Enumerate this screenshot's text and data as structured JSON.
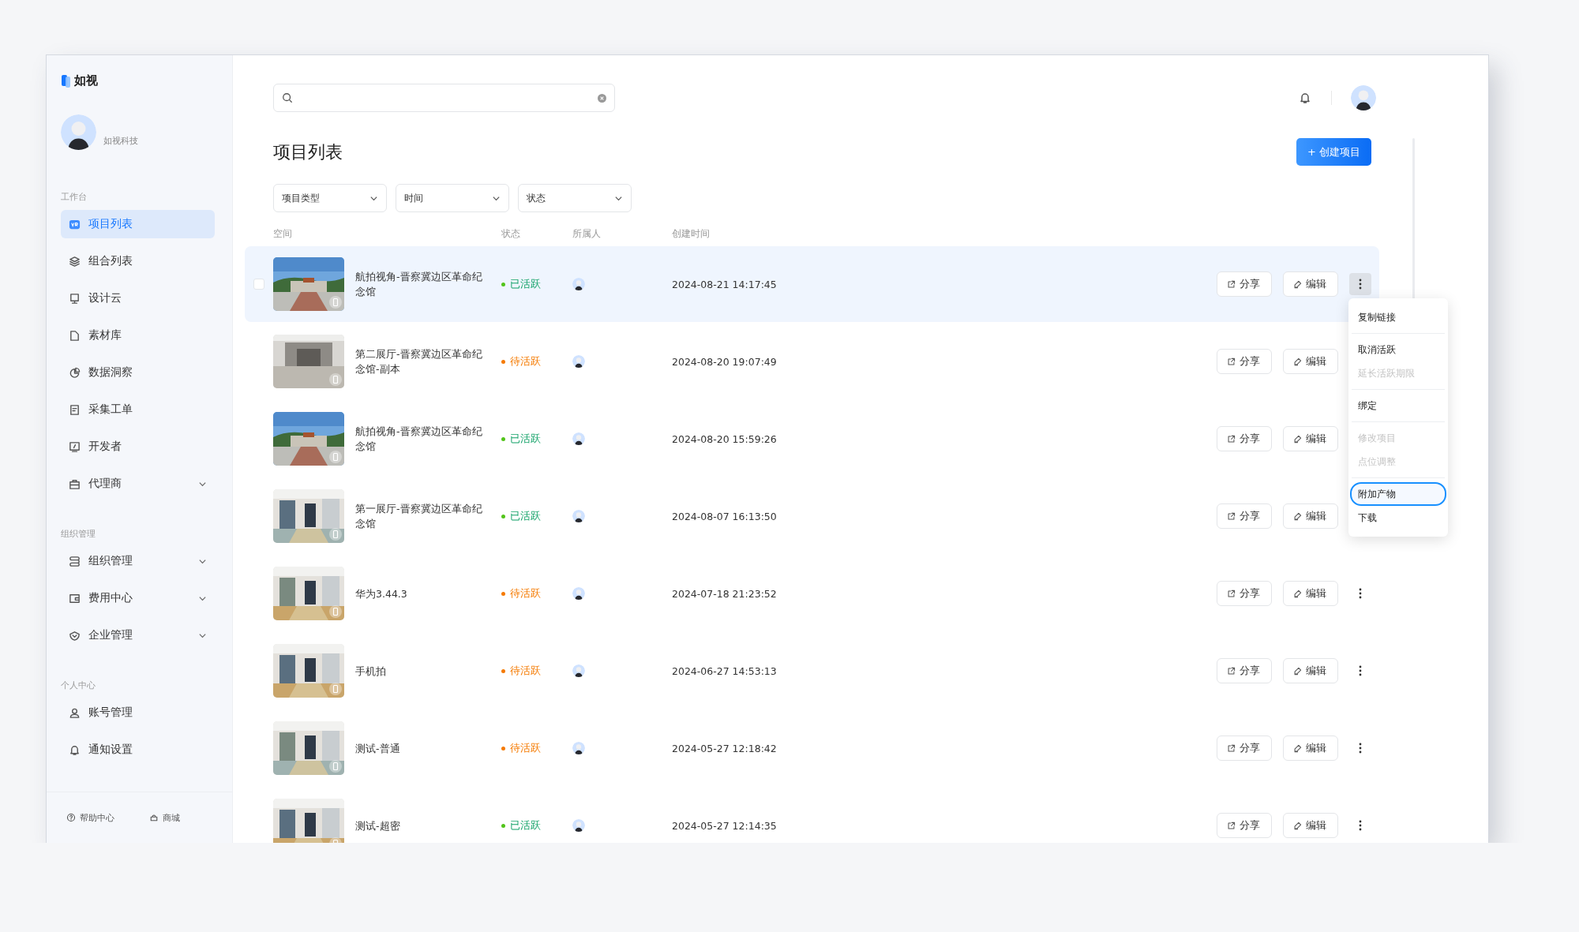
{
  "sidebar": {
    "logo_text": "如视",
    "user_name": "如视科技",
    "sections": [
      {
        "label": "工作台",
        "items": [
          {
            "label": "项目列表",
            "selected": true,
            "has_submenu": false
          },
          {
            "label": "组合列表",
            "selected": false,
            "has_submenu": false
          },
          {
            "label": "设计云",
            "selected": false,
            "has_submenu": false
          },
          {
            "label": "素材库",
            "selected": false,
            "has_submenu": false
          },
          {
            "label": "数据洞察",
            "selected": false,
            "has_submenu": false
          },
          {
            "label": "采集工单",
            "selected": false,
            "has_submenu": false
          },
          {
            "label": "开发者",
            "selected": false,
            "has_submenu": false
          },
          {
            "label": "代理商",
            "selected": false,
            "has_submenu": true
          }
        ]
      },
      {
        "label": "组织管理",
        "items": [
          {
            "label": "组织管理",
            "selected": false,
            "has_submenu": true
          },
          {
            "label": "费用中心",
            "selected": false,
            "has_submenu": true
          },
          {
            "label": "企业管理",
            "selected": false,
            "has_submenu": true
          }
        ]
      },
      {
        "label": "个人中心",
        "items": [
          {
            "label": "账号管理",
            "selected": false,
            "has_submenu": false
          },
          {
            "label": "通知设置",
            "selected": false,
            "has_submenu": false
          }
        ]
      }
    ],
    "footer_links": [
      "帮助中心",
      "商城"
    ]
  },
  "title": "项目列表",
  "create_button": "+ 创建项目",
  "filters": [
    "项目类型",
    "时间",
    "状态"
  ],
  "columns": [
    "空间",
    "状态",
    "所属人",
    "创建时间"
  ],
  "rows": [
    {
      "name": "航拍视角-晋察冀边区革命纪念馆",
      "status": "已活跃",
      "color": "#52c41a",
      "date": "2024-08-21 14:17:45",
      "selected": true,
      "share": "分享",
      "edit": "编辑"
    },
    {
      "name": "第二展厅-晋察冀边区革命纪念馆-副本",
      "status": "待活跃",
      "color": "#f57a00",
      "date": "2024-08-20 19:07:49",
      "selected": false,
      "share": "分享",
      "edit": "编辑"
    },
    {
      "name": "航拍视角-晋察冀边区革命纪念馆",
      "status": "已活跃",
      "color": "#52c41a",
      "date": "2024-08-20 15:59:26",
      "selected": false,
      "share": "分享",
      "edit": "编辑"
    },
    {
      "name": "第一展厅-晋察冀边区革命纪念馆",
      "status": "已活跃",
      "color": "#52c41a",
      "date": "2024-08-07 16:13:50",
      "selected": false,
      "share": "分享",
      "edit": "编辑"
    },
    {
      "name": "华为3.44.3",
      "status": "待活跃",
      "color": "#f57a00",
      "date": "2024-07-18 21:23:52",
      "selected": false,
      "share": "分享",
      "edit": "编辑"
    },
    {
      "name": "手机拍",
      "status": "待活跃",
      "color": "#f57a00",
      "date": "2024-06-27 14:53:13",
      "selected": false,
      "share": "分享",
      "edit": "编辑"
    },
    {
      "name": "测试-普通",
      "status": "待活跃",
      "color": "#f57a00",
      "date": "2024-05-27 12:18:42",
      "selected": false,
      "share": "分享",
      "edit": "编辑"
    },
    {
      "name": "测试-超密",
      "status": "已活跃",
      "color": "#52c41a",
      "date": "2024-05-27 12:14:35",
      "selected": false,
      "share": "分享",
      "edit": "编辑"
    }
  ],
  "row_menu": {
    "groups": [
      [
        {
          "label": "复制链接",
          "disabled": false,
          "selected": false
        }
      ],
      [
        {
          "label": "取消活跃",
          "disabled": false,
          "selected": false
        },
        {
          "label": "延长活跃期限",
          "disabled": true,
          "selected": false
        }
      ],
      [
        {
          "label": "绑定",
          "disabled": false,
          "selected": false
        }
      ],
      [
        {
          "label": "修改项目",
          "disabled": true,
          "selected": false
        },
        {
          "label": "点位调整",
          "disabled": true,
          "selected": false
        }
      ],
      [
        {
          "label": "附加产物",
          "disabled": false,
          "selected": true
        },
        {
          "label": "下载",
          "disabled": false,
          "selected": false
        }
      ]
    ]
  }
}
